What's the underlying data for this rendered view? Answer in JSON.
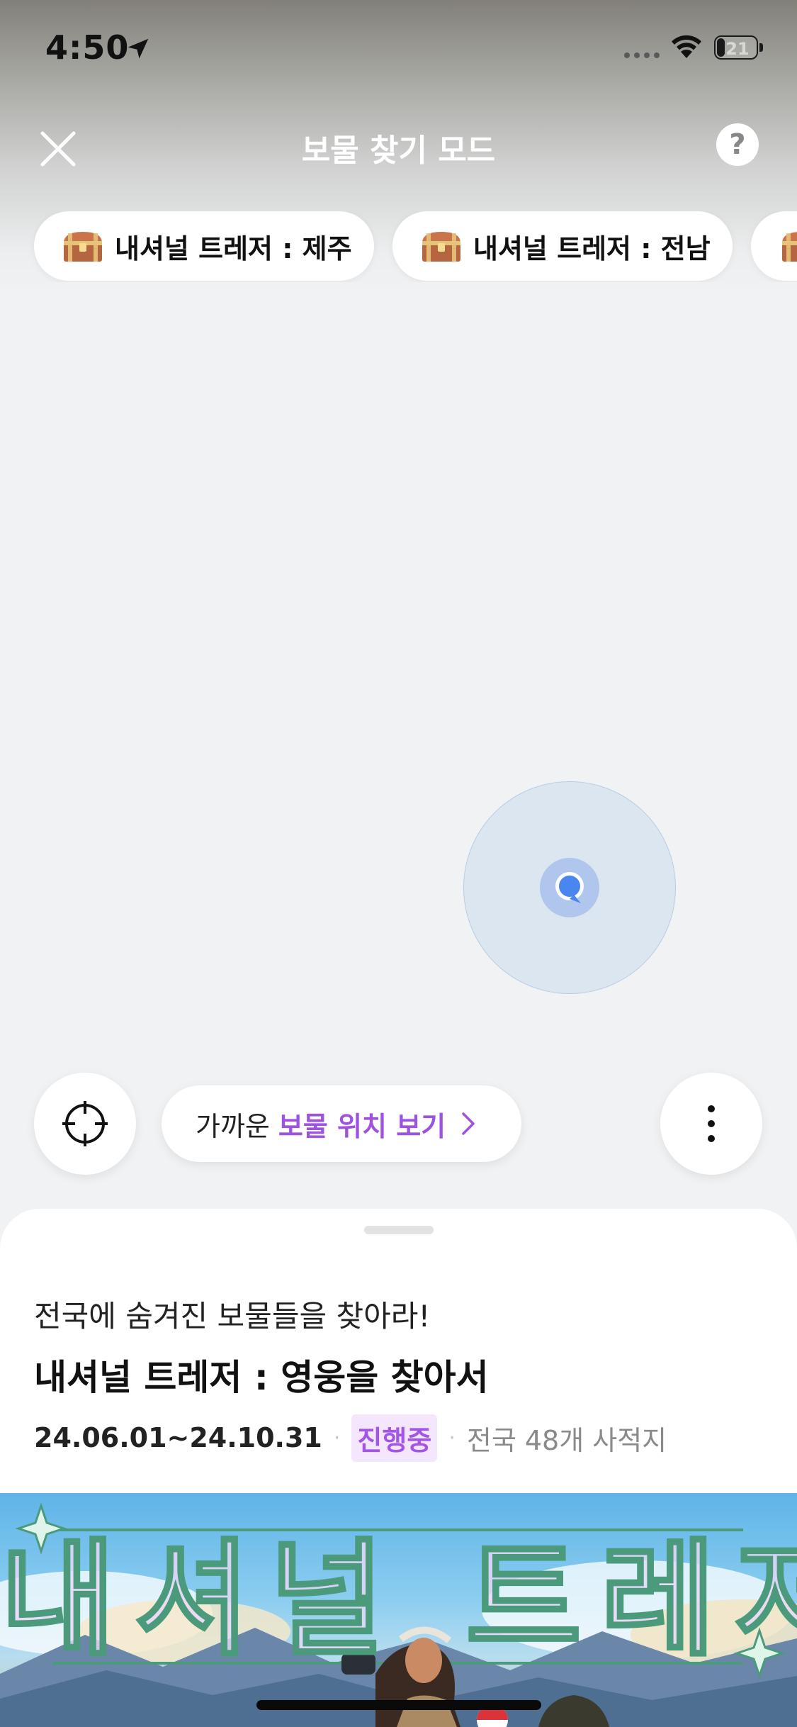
{
  "status_bar": {
    "time": "4:50",
    "battery": "21",
    "battery_level": 0.21
  },
  "nav": {
    "title": "보물 찾기 모드",
    "close_icon": "close-icon",
    "help_icon": "question-mark-icon",
    "help_glyph": "?"
  },
  "chips": [
    {
      "label": "내셔널 트레저 : 제주",
      "icon": "treasure-chest-icon"
    },
    {
      "label": "내셔널 트레저 : 전남",
      "icon": "treasure-chest-icon"
    },
    {
      "label": "",
      "icon": "treasure-chest-icon"
    }
  ],
  "map_controls": {
    "locate_icon": "crosshair-icon",
    "nearby_prefix": "가까운",
    "nearby_highlight": "보물 위치 보기",
    "nearby_chevron_icon": "chevron-right-icon",
    "more_icon": "more-vertical-icon"
  },
  "sheet": {
    "subtitle": "전국에 숨겨진 보물들을 찾아라!",
    "title": "내셔널 트레저 : 영웅을 찾아서",
    "date_range": "24.06.01~24.10.31",
    "separator": "·",
    "status": "진행중",
    "location": "전국 48개 사적지"
  },
  "banner": {
    "title": "내셔널 트레저"
  },
  "colors": {
    "accent_purple": "#9d52e0",
    "status_bg": "#f3e6fd",
    "map_bg": "#f0f2f4",
    "user_dot": "#4a86f0"
  }
}
